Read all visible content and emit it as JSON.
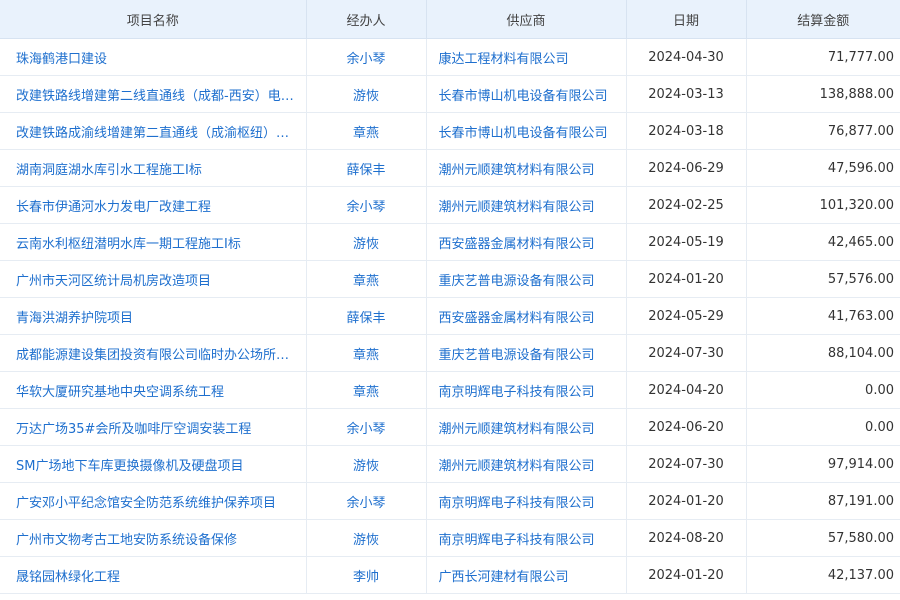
{
  "table": {
    "headers": [
      "项目名称",
      "经办人",
      "供应商",
      "日期",
      "结算金额"
    ],
    "rows": [
      {
        "name": "珠海鹤港口建设",
        "handler": "余小琴",
        "supplier": "康达工程材料有限公司",
        "date": "2024-04-30",
        "amount": "71,777.00"
      },
      {
        "name": "改建铁路线增建第二线直通线（成都-西安）电…",
        "handler": "游恢",
        "supplier": "长春市博山机电设备有限公司",
        "date": "2024-03-13",
        "amount": "138,888.00"
      },
      {
        "name": "改建铁路成渝线增建第二直通线（成渝枢纽）…",
        "handler": "章燕",
        "supplier": "长春市博山机电设备有限公司",
        "date": "2024-03-18",
        "amount": "76,877.00"
      },
      {
        "name": "湖南洞庭湖水库引水工程施工I标",
        "handler": "薛保丰",
        "supplier": "潮州元顺建筑材料有限公司",
        "date": "2024-06-29",
        "amount": "47,596.00"
      },
      {
        "name": "长春市伊通河水力发电厂改建工程",
        "handler": "余小琴",
        "supplier": "潮州元顺建筑材料有限公司",
        "date": "2024-02-25",
        "amount": "101,320.00"
      },
      {
        "name": "云南水利枢纽潜明水库一期工程施工I标",
        "handler": "游恢",
        "supplier": "西安盛器金属材料有限公司",
        "date": "2024-05-19",
        "amount": "42,465.00"
      },
      {
        "name": "广州市天河区统计局机房改造项目",
        "handler": "章燕",
        "supplier": "重庆艺普电源设备有限公司",
        "date": "2024-01-20",
        "amount": "57,576.00"
      },
      {
        "name": "青海洪湖养护院项目",
        "handler": "薛保丰",
        "supplier": "西安盛器金属材料有限公司",
        "date": "2024-05-29",
        "amount": "41,763.00"
      },
      {
        "name": "成都能源建设集团投资有限公司临时办公场所…",
        "handler": "章燕",
        "supplier": "重庆艺普电源设备有限公司",
        "date": "2024-07-30",
        "amount": "88,104.00"
      },
      {
        "name": "华软大厦研究基地中央空调系统工程",
        "handler": "章燕",
        "supplier": "南京明辉电子科技有限公司",
        "date": "2024-04-20",
        "amount": "0.00"
      },
      {
        "name": "万达广场35#会所及咖啡厅空调安装工程",
        "handler": "余小琴",
        "supplier": "潮州元顺建筑材料有限公司",
        "date": "2024-06-20",
        "amount": "0.00"
      },
      {
        "name": "SM广场地下车库更换摄像机及硬盘项目",
        "handler": "游恢",
        "supplier": "潮州元顺建筑材料有限公司",
        "date": "2024-07-30",
        "amount": "97,914.00"
      },
      {
        "name": "广安邓小平纪念馆安全防范系统维护保养项目",
        "handler": "余小琴",
        "supplier": "南京明辉电子科技有限公司",
        "date": "2024-01-20",
        "amount": "87,191.00"
      },
      {
        "name": "广州市文物考古工地安防系统设备保修",
        "handler": "游恢",
        "supplier": "南京明辉电子科技有限公司",
        "date": "2024-08-20",
        "amount": "57,580.00"
      },
      {
        "name": "晟铭园林绿化工程",
        "handler": "李帅",
        "supplier": "广西长河建材有限公司",
        "date": "2024-01-20",
        "amount": "42,137.00"
      }
    ]
  }
}
